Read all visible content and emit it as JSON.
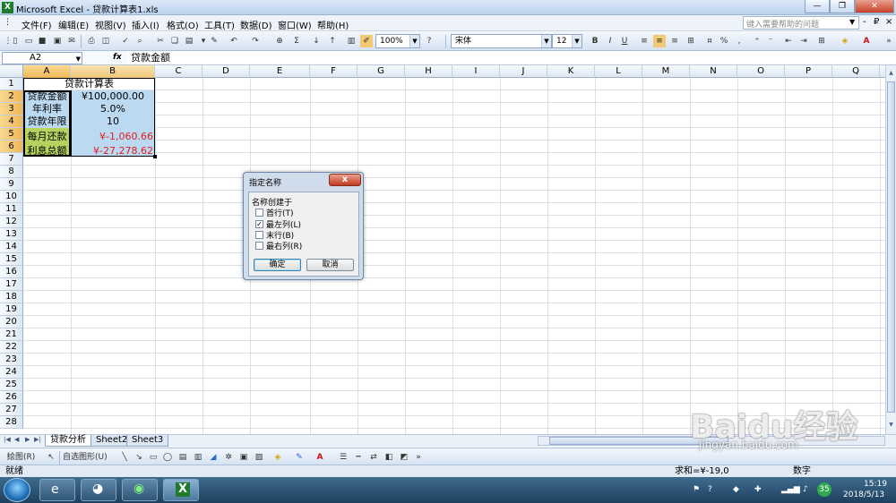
{
  "window": {
    "title": "Microsoft Excel - 贷款计算表1.xls",
    "app_icon": "excel-icon",
    "controls": [
      "—",
      "❐",
      "✕"
    ]
  },
  "menu": {
    "items": [
      "文件(F)",
      "编辑(E)",
      "视图(V)",
      "插入(I)",
      "格式(O)",
      "工具(T)",
      "数据(D)",
      "窗口(W)",
      "帮助(H)"
    ],
    "help_placeholder": "键入需要帮助的问题",
    "doc_controls": [
      "-",
      "₽",
      "×"
    ]
  },
  "toolbar": {
    "zoom": "100%",
    "font_name": "宋体",
    "font_size": "12",
    "bold": "B",
    "italic": "I",
    "underline": "U",
    "percent": "%",
    "comma": ","
  },
  "formula_bar": {
    "name_box": "A2",
    "fx": "fx",
    "content": "贷款金额"
  },
  "grid": {
    "columns": [
      "A",
      "B",
      "C",
      "D",
      "E",
      "F",
      "G",
      "H",
      "I",
      "J",
      "K",
      "L",
      "M",
      "N",
      "O",
      "P",
      "Q"
    ],
    "selected_column": "A",
    "rows": [
      "1",
      "2",
      "3",
      "4",
      "5",
      "6",
      "7",
      "8",
      "9",
      "10",
      "11",
      "12",
      "13",
      "14",
      "15",
      "16",
      "17",
      "18",
      "19",
      "20",
      "21",
      "22",
      "23",
      "24",
      "25",
      "26",
      "27",
      "28"
    ],
    "selected_rows": [
      "2",
      "3",
      "4",
      "5",
      "6"
    ],
    "cells": {
      "title": "贷款计算表",
      "a2": "贷款金额",
      "b2": "¥100,000.00",
      "a3": "年利率",
      "b3": "5.0%",
      "a4": "贷款年限",
      "b4": "10",
      "a5": "每月还款",
      "b5": "¥-1,060.66",
      "a6": "利息总额",
      "b6": "¥-27,278.62"
    },
    "colors": {
      "input_fill": "#bcd9f2",
      "result_label_fill": "#b6d35f",
      "result_value_fill": "#bcd9f2",
      "negative_text": "#e02020",
      "selected_header": "#f0b65a"
    }
  },
  "sheets": {
    "tabs": [
      "贷款分析",
      "Sheet2",
      "Sheet3"
    ],
    "active": "贷款分析"
  },
  "drawing_toolbar": {
    "draw_label": "绘图(R)",
    "autoshape_label": "自选图形(U)"
  },
  "status": {
    "left": "就绪",
    "sum": "求和=¥-19,0",
    "num": "数字"
  },
  "dialog": {
    "title": "指定名称",
    "group_label": "名称创建于",
    "options": [
      {
        "label": "首行(T)",
        "checked": false
      },
      {
        "label": "最左列(L)",
        "checked": true
      },
      {
        "label": "末行(B)",
        "checked": false
      },
      {
        "label": "最右列(R)",
        "checked": false
      }
    ],
    "ok": "确定",
    "cancel": "取消",
    "close": "x"
  },
  "taskbar": {
    "time": "15:19",
    "date": "2018/5/13",
    "badge": "35"
  },
  "watermark": {
    "brand": "Baidu经验",
    "sub": "jingyan.baidu.com"
  }
}
